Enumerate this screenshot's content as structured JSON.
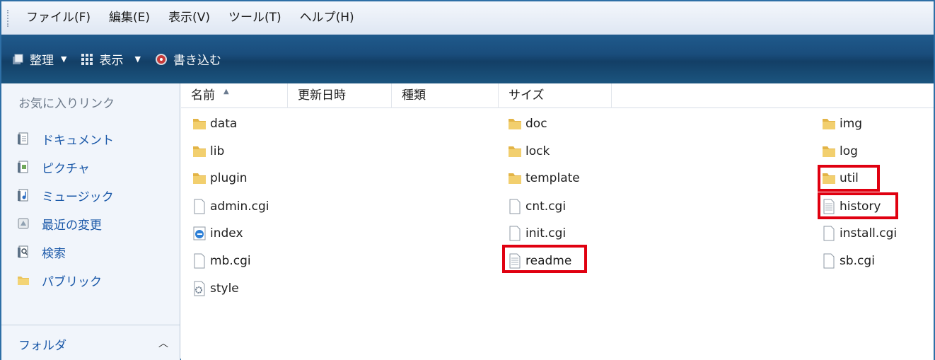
{
  "menubar": {
    "items": [
      "ファイル(F)",
      "編集(E)",
      "表示(V)",
      "ツール(T)",
      "ヘルプ(H)"
    ]
  },
  "toolbar": {
    "organize_label": "整理",
    "view_label": "表示",
    "burn_label": "書き込む"
  },
  "navpane": {
    "header": "お気に入りリンク",
    "items": [
      "ドキュメント",
      "ピクチャ",
      "ミュージック",
      "最近の変更",
      "検索",
      "パブリック"
    ],
    "footer": "フォルダ"
  },
  "columns": [
    "名前",
    "更新日時",
    "種類",
    "サイズ"
  ],
  "files": {
    "col1": [
      "data",
      "lib",
      "plugin",
      "admin.cgi",
      "index",
      "mb.cgi",
      "style"
    ],
    "col2": [
      "doc",
      "lock",
      "template",
      "cnt.cgi",
      "init.cgi",
      "readme"
    ],
    "col3": [
      "img",
      "log",
      "util",
      "history",
      "install.cgi",
      "sb.cgi"
    ]
  },
  "colors": {
    "toolbar_bg": "#1a4d7c",
    "nav_link": "#1a58a8",
    "highlight": "#e00010"
  }
}
